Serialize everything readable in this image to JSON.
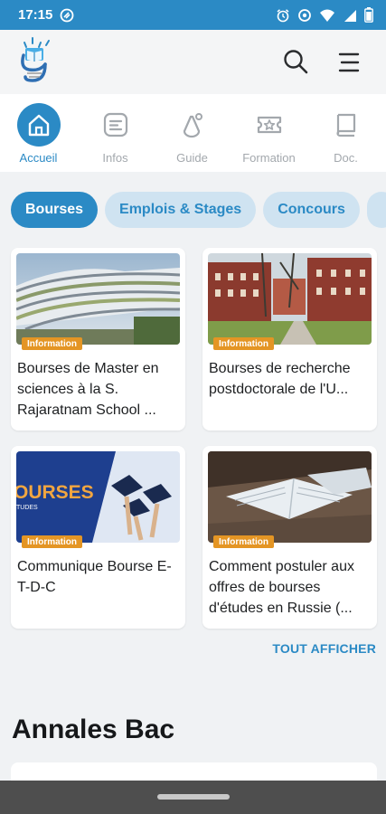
{
  "status_bar": {
    "time": "17:15",
    "icons": [
      "app-notification-icon",
      "alarm-icon",
      "data-saver-icon",
      "wifi-icon",
      "signal-icon",
      "battery-icon"
    ]
  },
  "app_bar": {
    "logo": "app-logo",
    "search_icon": "search-icon",
    "menu_icon": "hamburger-menu-icon"
  },
  "tabs": [
    {
      "label": "Accueil",
      "icon": "home-icon",
      "active": true
    },
    {
      "label": "Infos",
      "icon": "document-lines-icon",
      "active": false
    },
    {
      "label": "Guide",
      "icon": "compass-guide-icon",
      "active": false
    },
    {
      "label": "Formation",
      "icon": "ticket-star-icon",
      "active": false
    },
    {
      "label": "Doc.",
      "icon": "book-icon",
      "active": false
    }
  ],
  "chips": [
    {
      "label": "Bourses",
      "active": true
    },
    {
      "label": "Emplois & Stages",
      "active": false
    },
    {
      "label": "Concours",
      "active": false
    },
    {
      "label": "",
      "active": false
    }
  ],
  "cards": [
    {
      "badge": "Information",
      "title": "Bourses de Master en sciences à la S. Rajaratnam School ..."
    },
    {
      "badge": "Information",
      "title": "Bourses de recherche postdoctorale de l'U..."
    },
    {
      "badge": "Information",
      "title": "Communique Bourse E-T-D-C",
      "image_text": "OURSES",
      "image_subtext": "TUDES"
    },
    {
      "badge": "Information",
      "title": "Comment postuler aux offres de bourses d'études en Russie (..."
    }
  ],
  "show_all": "TOUT AFFICHER",
  "section_title": "Annales Bac",
  "colors": {
    "primary": "#2b8ac5",
    "chip_inactive_bg": "#cfe3f1",
    "badge": "#e49524",
    "background": "#f0f2f4"
  }
}
